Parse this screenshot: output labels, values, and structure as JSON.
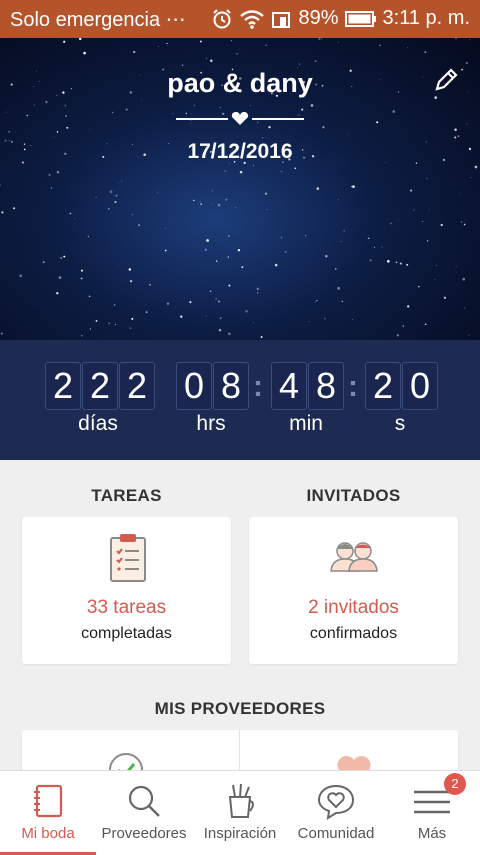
{
  "status_bar": {
    "carrier": "Solo emergencia",
    "dots": "⋯",
    "battery": "89%",
    "time": "3:11 p. m."
  },
  "header": {
    "names": "pao & dany",
    "date": "17/12/2016"
  },
  "countdown": {
    "days_digits": [
      "2",
      "2",
      "2"
    ],
    "hours_digits": [
      "0",
      "8"
    ],
    "minutes_digits": [
      "4",
      "8"
    ],
    "seconds_digits": [
      "2",
      "0"
    ],
    "days_label": "días",
    "hours_label": "hrs",
    "minutes_label": "min",
    "seconds_label": "s"
  },
  "tareas": {
    "title": "TAREAS",
    "count": "33 tareas",
    "subtitle": "completadas"
  },
  "invitados": {
    "title": "INVITADOS",
    "count": "2 invitados",
    "subtitle": "confirmados"
  },
  "proveedores": {
    "title": "MIS PROVEEDORES"
  },
  "nav": {
    "items": [
      {
        "label": "Mi boda",
        "icon": "notebook-icon"
      },
      {
        "label": "Proveedores",
        "icon": "search-icon"
      },
      {
        "label": "Inspiración",
        "icon": "art-supplies-icon"
      },
      {
        "label": "Comunidad",
        "icon": "chat-heart-icon"
      },
      {
        "label": "Más",
        "icon": "menu-icon"
      }
    ],
    "badge": "2"
  },
  "colors": {
    "accent": "#d35b4f",
    "status_bar": "#b5542a",
    "countdown_bg": "#1d2a52"
  }
}
